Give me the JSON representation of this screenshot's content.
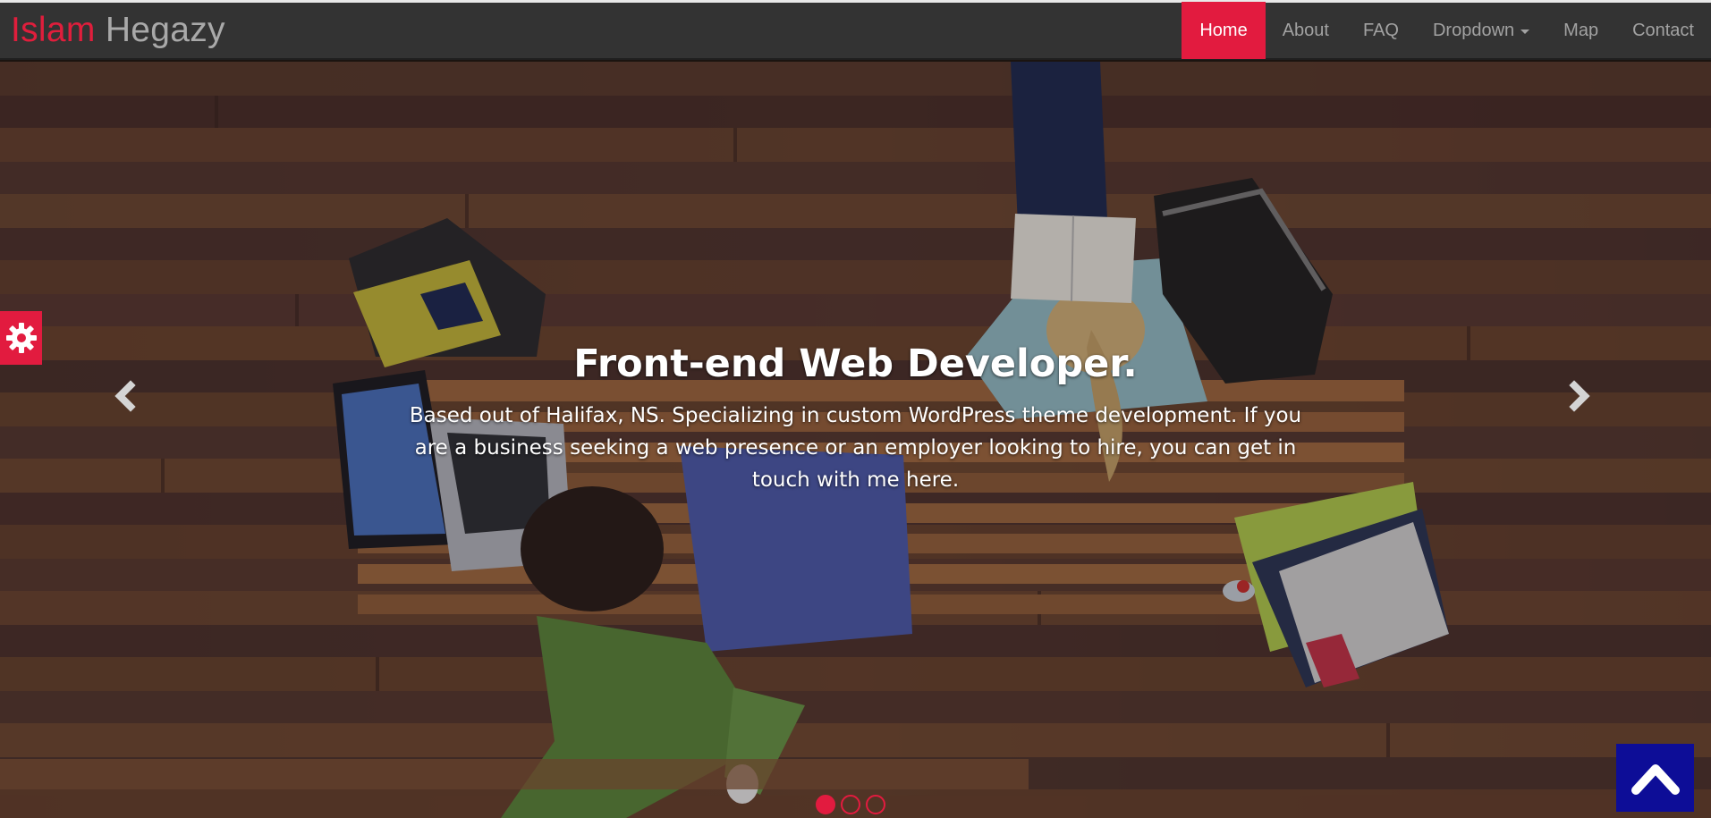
{
  "brand": {
    "first": "Islam",
    "last": "Hegazy"
  },
  "nav": {
    "items": [
      {
        "label": "Home",
        "active": true
      },
      {
        "label": "About"
      },
      {
        "label": "FAQ"
      },
      {
        "label": "Dropdown",
        "has_caret": true
      },
      {
        "label": "Map"
      },
      {
        "label": "Contact"
      }
    ]
  },
  "hero": {
    "title": "Front-end Web Developer.",
    "text": "Based out of Halifax, NS. Specializing in custom WordPress theme development. If you are a business seeking a web presence or an employer looking to hire, you can get in touch with me here.",
    "slide_count": 3,
    "active_slide": 1
  },
  "icons": {
    "prev": "chevron-left-icon",
    "next": "chevron-right-icon",
    "settings": "gear-icon",
    "back_to_top": "chevron-up-icon"
  },
  "colors": {
    "accent": "#e21b3f",
    "navbar": "#333333",
    "back_to_top": "#0d0d97"
  }
}
